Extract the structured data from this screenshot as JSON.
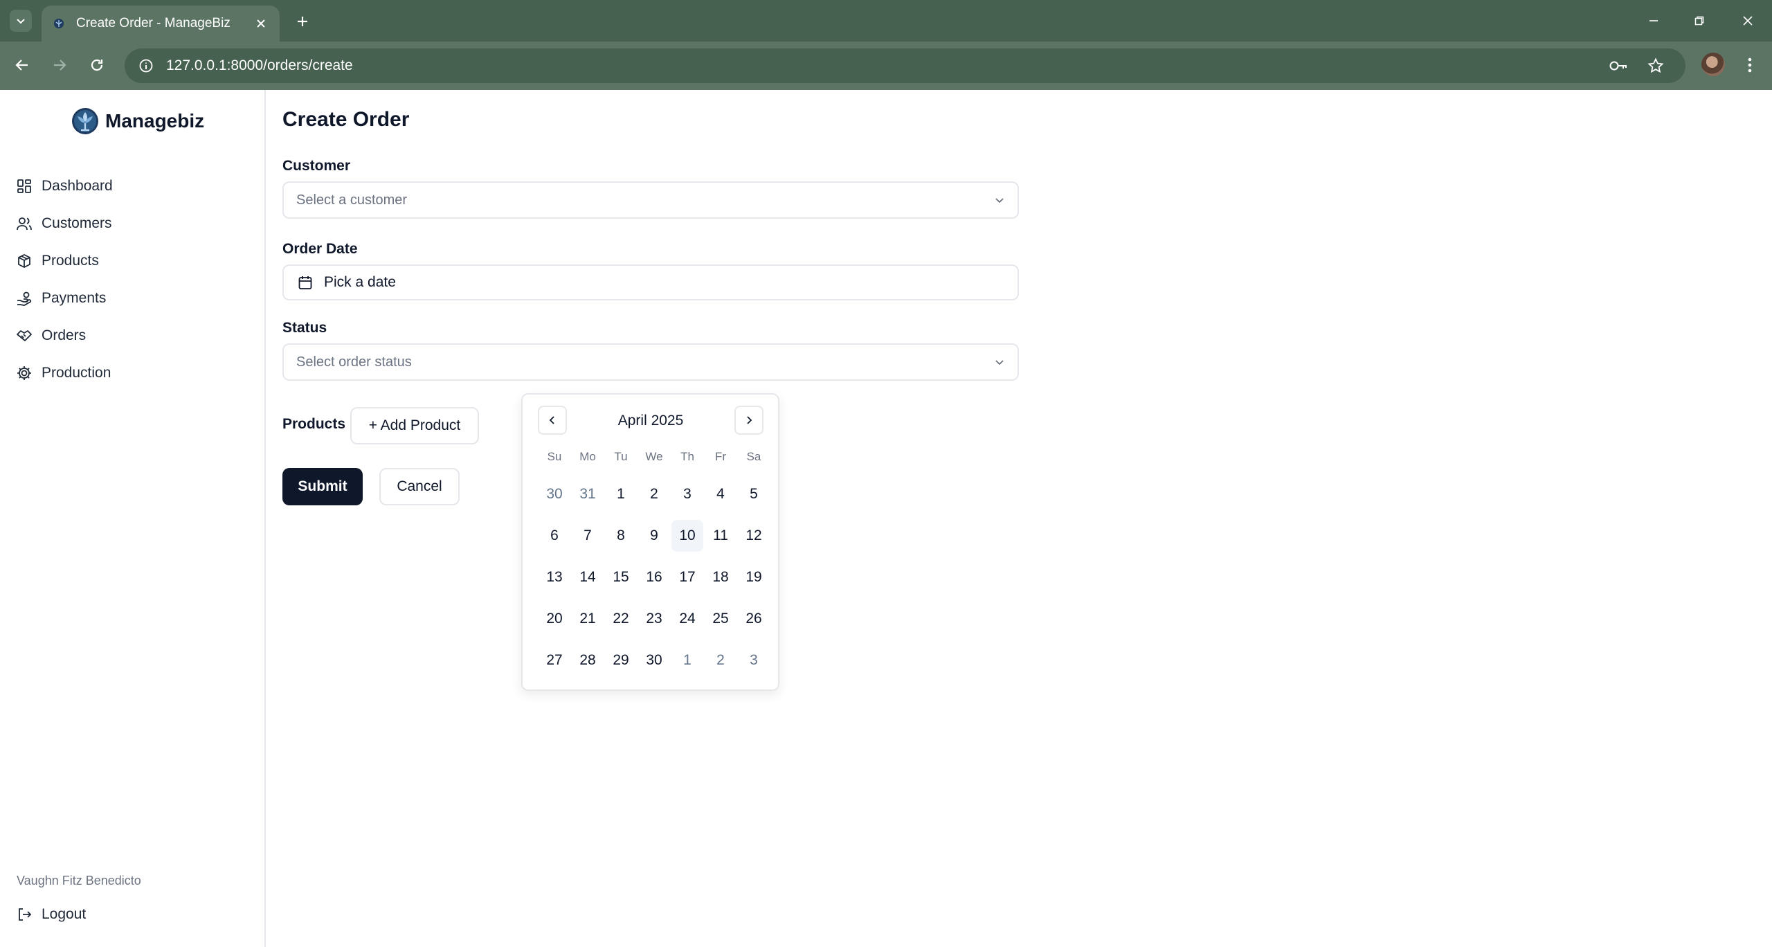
{
  "browser": {
    "tab_title": "Create Order - ManageBiz",
    "url": "127.0.0.1:8000/orders/create"
  },
  "sidebar": {
    "brand": "Managebiz",
    "items": [
      {
        "label": "Dashboard",
        "icon": "dashboard-icon"
      },
      {
        "label": "Customers",
        "icon": "users-icon"
      },
      {
        "label": "Products",
        "icon": "package-icon"
      },
      {
        "label": "Payments",
        "icon": "payments-icon"
      },
      {
        "label": "Orders",
        "icon": "handshake-icon"
      },
      {
        "label": "Production",
        "icon": "cog-icon"
      }
    ],
    "user_name": "Vaughn Fitz Benedicto",
    "logout_label": "Logout"
  },
  "form": {
    "title": "Create Order",
    "customer_label": "Customer",
    "customer_placeholder": "Select a customer",
    "order_date_label": "Order Date",
    "order_date_placeholder": "Pick a date",
    "status_label": "Status",
    "status_placeholder": "Select order status",
    "products_label": "Products",
    "add_product_label": "+ Add Product",
    "submit_label": "Submit",
    "cancel_label": "Cancel"
  },
  "calendar": {
    "month_label": "April 2025",
    "weekdays": [
      "Su",
      "Mo",
      "Tu",
      "We",
      "Th",
      "Fr",
      "Sa"
    ],
    "today": "10",
    "days": [
      {
        "d": "30",
        "outside": true
      },
      {
        "d": "31",
        "outside": true
      },
      {
        "d": "1"
      },
      {
        "d": "2"
      },
      {
        "d": "3"
      },
      {
        "d": "4"
      },
      {
        "d": "5"
      },
      {
        "d": "6"
      },
      {
        "d": "7"
      },
      {
        "d": "8"
      },
      {
        "d": "9"
      },
      {
        "d": "10",
        "today": true
      },
      {
        "d": "11"
      },
      {
        "d": "12"
      },
      {
        "d": "13"
      },
      {
        "d": "14"
      },
      {
        "d": "15"
      },
      {
        "d": "16"
      },
      {
        "d": "17"
      },
      {
        "d": "18"
      },
      {
        "d": "19"
      },
      {
        "d": "20"
      },
      {
        "d": "21"
      },
      {
        "d": "22"
      },
      {
        "d": "23"
      },
      {
        "d": "24"
      },
      {
        "d": "25"
      },
      {
        "d": "26"
      },
      {
        "d": "27"
      },
      {
        "d": "28"
      },
      {
        "d": "29"
      },
      {
        "d": "30"
      },
      {
        "d": "1",
        "outside": true
      },
      {
        "d": "2",
        "outside": true
      },
      {
        "d": "3",
        "outside": true
      }
    ]
  },
  "colors": {
    "browser_frame": "#466150",
    "browser_toolbar": "#5b7463",
    "primary_button": "#0f172a",
    "border": "#e5e7eb"
  }
}
